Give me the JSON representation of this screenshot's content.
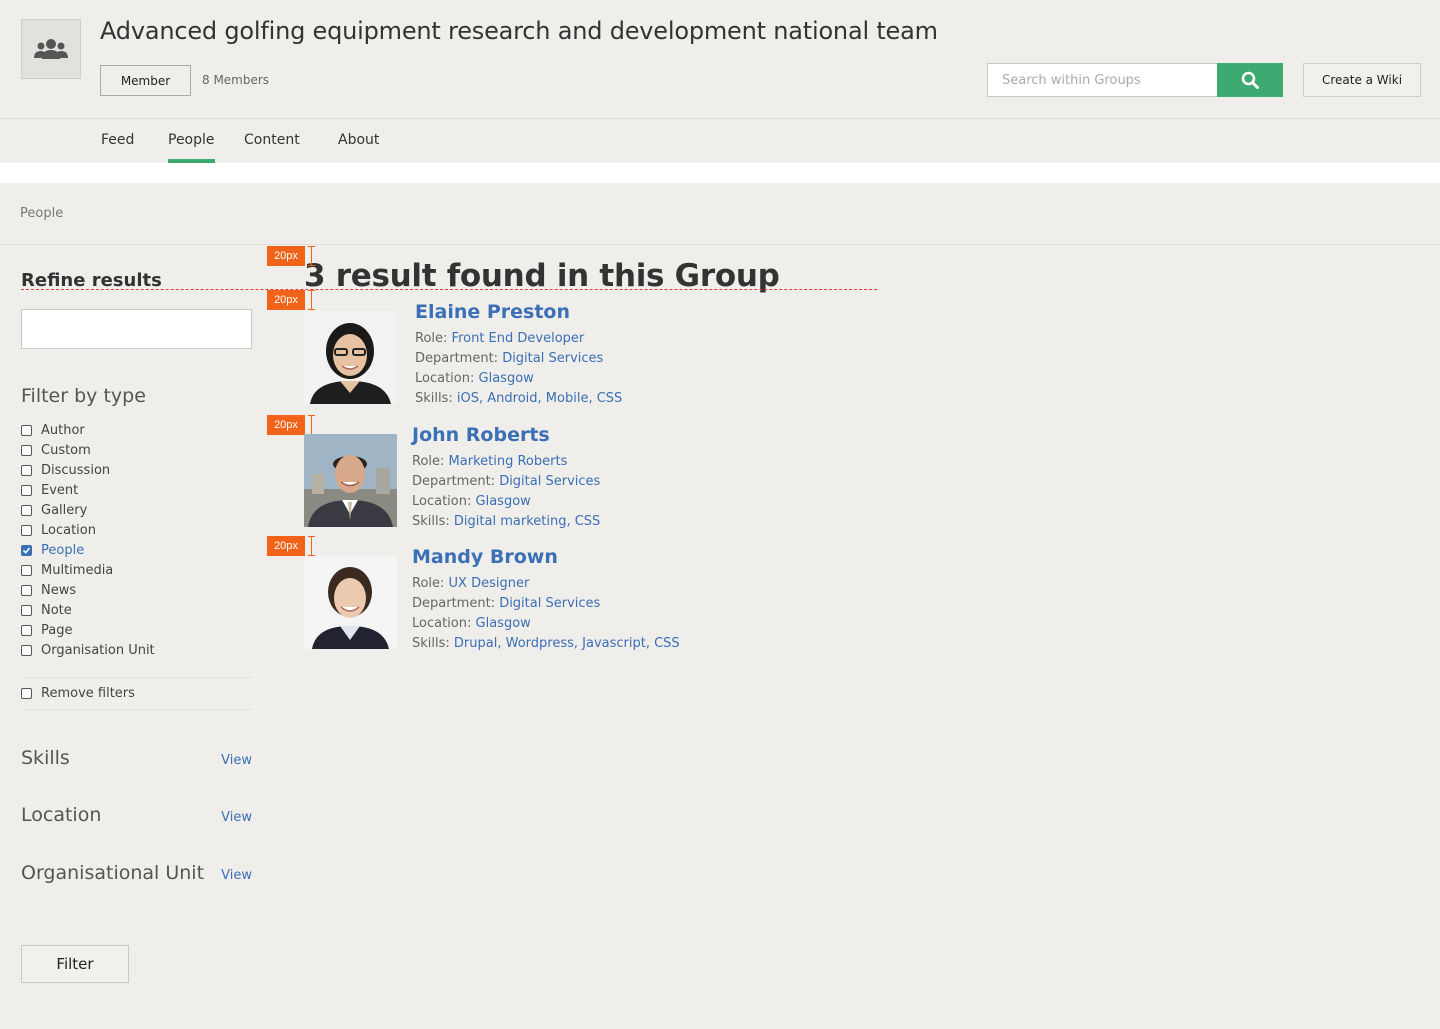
{
  "header": {
    "group_title": "Advanced golfing equipment research and development national team",
    "member_button": "Member",
    "member_count": "8 Members",
    "search_placeholder": "Search within Groups",
    "create_wiki": "Create a Wiki",
    "colors": {
      "accent": "#3daa72",
      "link": "#3b6fb6"
    }
  },
  "tabs": [
    {
      "label": "Feed",
      "active": false
    },
    {
      "label": "People",
      "active": true
    },
    {
      "label": "Content",
      "active": false
    },
    {
      "label": "About",
      "active": false
    }
  ],
  "breadcrumb": "People",
  "sidebar": {
    "refine_title": "Refine results",
    "filter_title": "Filter by type",
    "filters": [
      {
        "label": "Author",
        "checked": false
      },
      {
        "label": "Custom",
        "checked": false
      },
      {
        "label": "Discussion",
        "checked": false
      },
      {
        "label": "Event",
        "checked": false
      },
      {
        "label": "Gallery",
        "checked": false
      },
      {
        "label": "Location",
        "checked": false
      },
      {
        "label": "People",
        "checked": true
      },
      {
        "label": "Multimedia",
        "checked": false
      },
      {
        "label": "News",
        "checked": false
      },
      {
        "label": "Note",
        "checked": false
      },
      {
        "label": "Page",
        "checked": false
      },
      {
        "label": "Organisation Unit",
        "checked": false
      }
    ],
    "remove_filters": "Remove filters",
    "facets": [
      {
        "label": "Skills",
        "link": "View"
      },
      {
        "label": "Location",
        "link": "View"
      },
      {
        "label": "Organisational Unit",
        "link": "View"
      }
    ],
    "filter_button": "Filter"
  },
  "results": {
    "title": "3 result found in this Group",
    "spacing_label": "20px",
    "people": [
      {
        "name": "Elaine Preston",
        "role_label": "Role:",
        "role": "Front End Developer",
        "dept_label": "Department:",
        "department": "Digital Services",
        "loc_label": "Location:",
        "location": "Glasgow",
        "skills_label": "Skills:",
        "skills": "iOS, Android, Mobile, CSS"
      },
      {
        "name": "John Roberts",
        "role_label": "Role:",
        "role": "Marketing Roberts",
        "dept_label": "Department:",
        "department": "Digital Services",
        "loc_label": "Location:",
        "location": "Glasgow",
        "skills_label": "Skills:",
        "skills": "Digital marketing, CSS"
      },
      {
        "name": "Mandy Brown",
        "role_label": "Role:",
        "role": "UX Designer",
        "dept_label": "Department:",
        "department": "Digital Services",
        "loc_label": "Location:",
        "location": "Glasgow",
        "skills_label": "Skills:",
        "skills": "Drupal, Wordpress, Javascript, CSS"
      }
    ]
  }
}
